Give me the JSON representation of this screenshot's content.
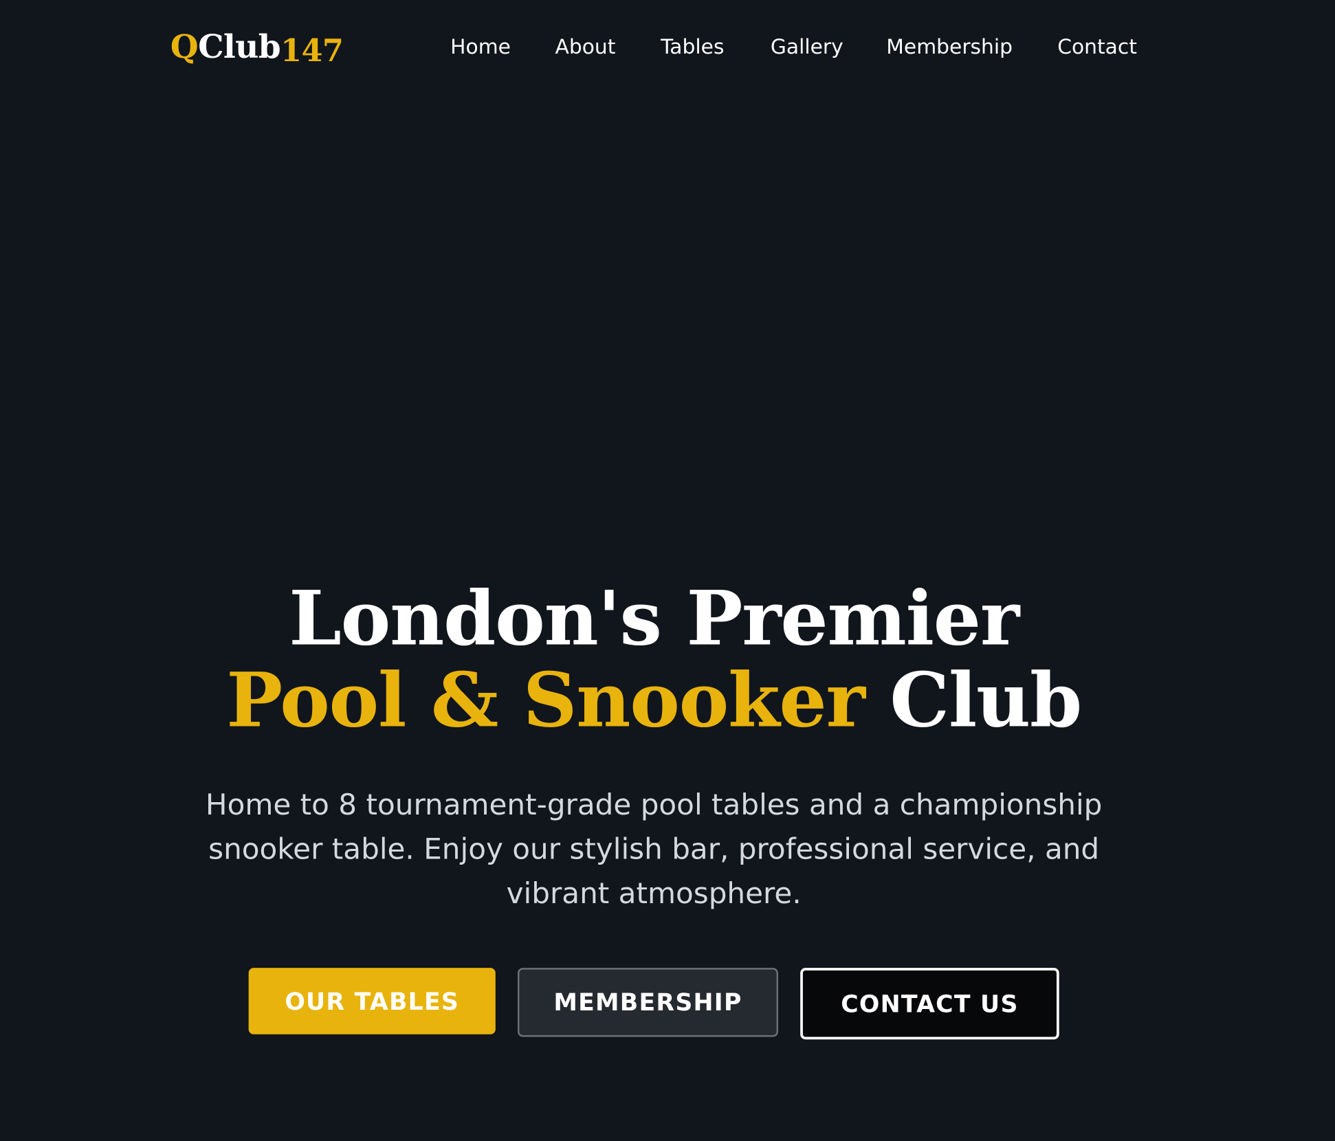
{
  "brand": {
    "q": "Q",
    "club": "Club",
    "number": "147"
  },
  "nav": {
    "items": [
      {
        "label": "Home"
      },
      {
        "label": "About"
      },
      {
        "label": "Tables"
      },
      {
        "label": "Gallery"
      },
      {
        "label": "Membership"
      },
      {
        "label": "Contact"
      }
    ]
  },
  "hero": {
    "title_line1": "London's Premier",
    "title_accent": "Pool & Snooker",
    "title_end": "Club",
    "subtitle": "Home to 8 tournament-grade pool tables and a championship snooker table. Enjoy our stylish bar, professional service, and vibrant atmosphere.",
    "buttons": {
      "tables": "OUR TABLES",
      "membership": "MEMBERSHIP",
      "contact": "CONTACT US"
    }
  },
  "colors": {
    "background": "#11151c",
    "accent": "#e8b30d",
    "text": "#ffffff",
    "subtext": "#d5d8de"
  }
}
